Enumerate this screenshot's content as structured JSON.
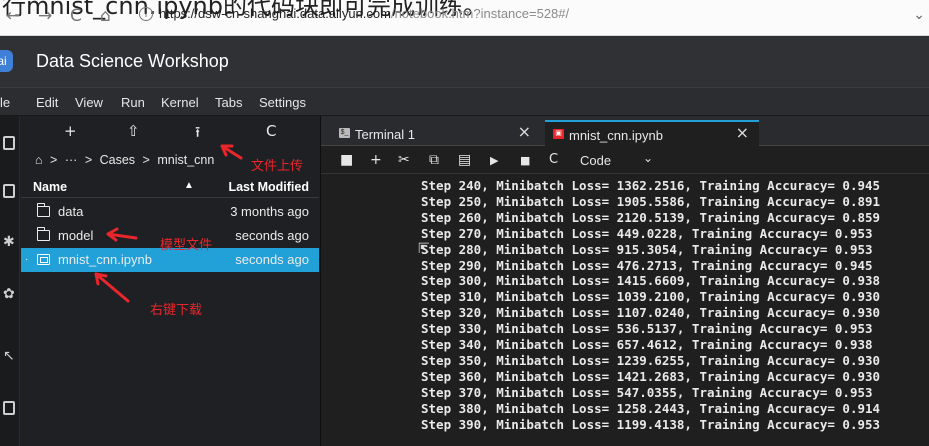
{
  "browser": {
    "overlay_caption": "行mnist_cnn.ipynb的代码块即可完成训练。",
    "back": "←",
    "forward": "→",
    "reload": "C",
    "home": "⌂",
    "info": "i",
    "url_host": "https://dsw-cn-shanghai.data.aliyun.com",
    "url_path": "/notebook.htm?instance=528#/",
    "menu_caret": "⌄"
  },
  "app": {
    "logo": "ai",
    "title": "Data Science Workshop"
  },
  "menubar": [
    "le",
    "Edit",
    "View",
    "Run",
    "Kernel",
    "Tabs",
    "Settings"
  ],
  "filebrowser": {
    "tools": [
      "+",
      "⇧",
      "⭱",
      "C"
    ],
    "breadcrumb": [
      "⌂",
      ">",
      "···",
      ">",
      "Cases",
      ">",
      "mnist_cnn"
    ],
    "header": {
      "name": "Name",
      "sort": "▲",
      "modified": "Last Modified"
    },
    "rows": [
      {
        "name": "data",
        "modified": "3 months ago",
        "type": "folder",
        "selected": false
      },
      {
        "name": "model",
        "modified": "seconds ago",
        "type": "folder",
        "selected": false
      },
      {
        "name": "mnist_cnn.ipynb",
        "modified": "seconds ago",
        "type": "notebook",
        "selected": true
      }
    ]
  },
  "annotations": {
    "upload": "文件上传",
    "model_file": "模型文件",
    "right_click_download": "右键下载"
  },
  "tabs": [
    {
      "label": "Terminal 1",
      "icon": "$_",
      "close": "×",
      "active": false
    },
    {
      "label": "mnist_cnn.ipynb",
      "icon": "▣",
      "close": "×",
      "active": true
    }
  ],
  "notebook_toolbar": {
    "save": "■",
    "add": "+",
    "cut": "✂",
    "copy": "⧉",
    "paste": "▤",
    "run": "▶",
    "stop": "■",
    "restart": "C",
    "cell_type": "Code",
    "caret": "⌄"
  },
  "output_lines": [
    "Step 240, Minibatch Loss= 1362.2516, Training Accuracy= 0.945",
    "Step 250, Minibatch Loss= 1905.5586, Training Accuracy= 0.891",
    "Step 260, Minibatch Loss= 2120.5139, Training Accuracy= 0.859",
    "Step 270, Minibatch Loss= 449.0228, Training Accuracy= 0.953",
    "Step 280, Minibatch Loss= 915.3054, Training Accuracy= 0.953",
    "Step 290, Minibatch Loss= 476.2713, Training Accuracy= 0.945",
    "Step 300, Minibatch Loss= 1415.6609, Training Accuracy= 0.938",
    "Step 310, Minibatch Loss= 1039.2100, Training Accuracy= 0.930",
    "Step 320, Minibatch Loss= 1107.0240, Training Accuracy= 0.930",
    "Step 330, Minibatch Loss= 536.5137, Training Accuracy= 0.953",
    "Step 340, Minibatch Loss= 657.4612, Training Accuracy= 0.938",
    "Step 350, Minibatch Loss= 1239.6255, Training Accuracy= 0.930",
    "Step 360, Minibatch Loss= 1421.2683, Training Accuracy= 0.930",
    "Step 370, Minibatch Loss= 547.0355, Training Accuracy= 0.953",
    "Step 380, Minibatch Loss= 1258.2443, Training Accuracy= 0.914",
    "Step 390, Minibatch Loss= 1199.4138, Training Accuracy= 0.953"
  ],
  "colors": {
    "accent": "#22a0d8",
    "annotation": "#e8262b",
    "header_bg": "#2f3135"
  }
}
